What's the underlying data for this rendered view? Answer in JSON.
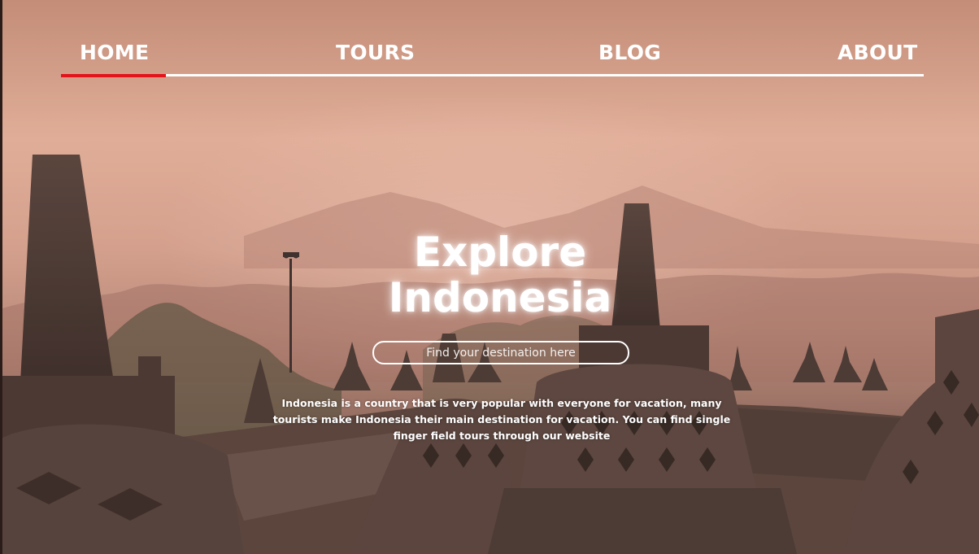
{
  "nav": {
    "items": [
      {
        "label": "HOME"
      },
      {
        "label": "TOURS"
      },
      {
        "label": "BLOG"
      },
      {
        "label": "ABOUT"
      }
    ],
    "active": "HOME"
  },
  "hero": {
    "title_line1": "Explore",
    "title_line2": "Indonesia",
    "search_placeholder": "Find your destination here",
    "description": "Indonesia is a country that is very popular with everyone for vacation, many tourists make Indonesia their main destination for vacation. You can find single finger field tours through our website"
  },
  "colors": {
    "accent": "#e4121a",
    "sky_top": "#c88d77",
    "mist": "#d9a896",
    "stone": "#3a2c28"
  }
}
